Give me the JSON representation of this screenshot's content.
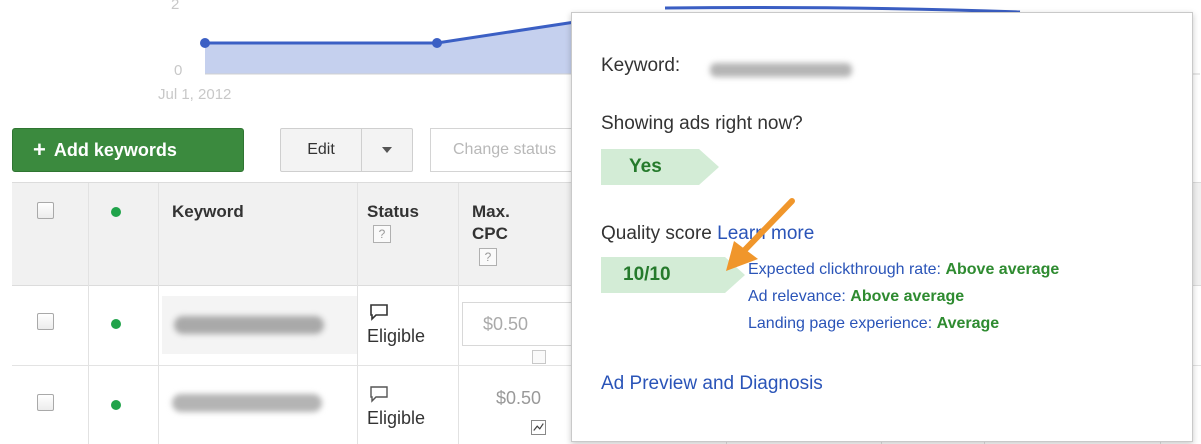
{
  "chart": {
    "y_tick_top": "2",
    "y_tick_zero": "0",
    "x_tick_start": "Jul 1, 2012",
    "series_color": "#3b5fc4",
    "fill_color": "#c5d0ee"
  },
  "toolbar": {
    "add_keywords_label": "Add keywords",
    "edit_label": "Edit",
    "change_status_label": "Change status"
  },
  "table": {
    "columns": {
      "keyword": "Keyword",
      "status": "Status",
      "max_cpc_line1": "Max.",
      "max_cpc_line2": "CPC",
      "help_mark": "?"
    },
    "rows": [
      {
        "status": "Eligible",
        "max_cpc": "$0.50"
      },
      {
        "status": "Eligible",
        "max_cpc": "$0.50"
      }
    ]
  },
  "popup": {
    "keyword_label": "Keyword:",
    "showing_ads_question": "Showing ads right now?",
    "showing_ads_answer": "Yes",
    "quality_score_label": "Quality score",
    "learn_more_link": "Learn more",
    "quality_score_value": "10/10",
    "expected_ctr_label": "Expected clickthrough rate:",
    "expected_ctr_value": "Above average",
    "ad_relevance_label": "Ad relevance:",
    "ad_relevance_value": "Above average",
    "landing_page_label": "Landing page experience:",
    "landing_page_value": "Average",
    "ad_preview_link": "Ad Preview and Diagnosis",
    "arrow_color": "#f0962b"
  },
  "colors": {
    "status_dot": "#20a34a",
    "add_button": "#3b8a3e",
    "link_blue": "#2a54b8",
    "value_green": "#2e8b30",
    "badge_green_bg": "#d3ecd6"
  }
}
